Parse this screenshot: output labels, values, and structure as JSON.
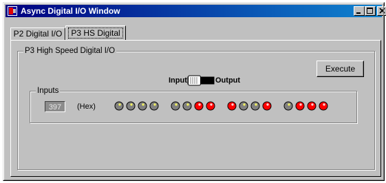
{
  "window": {
    "title": "Async Digital I/O Window"
  },
  "tabs": [
    {
      "label": "P2 Digital I/O",
      "active": false
    },
    {
      "label": "P3 HS Digital",
      "active": true
    }
  ],
  "panel": {
    "group_title": "P3  High Speed Digital I/O",
    "execute_label": "Execute",
    "switch": {
      "left_label": "Input",
      "right_label": "Output",
      "state": "Input"
    }
  },
  "inputs": {
    "group_title": "Inputs",
    "value": "397",
    "unit": "(Hex)",
    "leds": [
      "off",
      "off",
      "off",
      "off",
      "off",
      "off",
      "on",
      "on",
      "on",
      "off",
      "off",
      "on",
      "off",
      "on",
      "on",
      "on"
    ]
  },
  "colors": {
    "led_on": "#ff0000",
    "led_off": "#808080",
    "title_start": "#000080",
    "title_end": "#1084d0"
  }
}
